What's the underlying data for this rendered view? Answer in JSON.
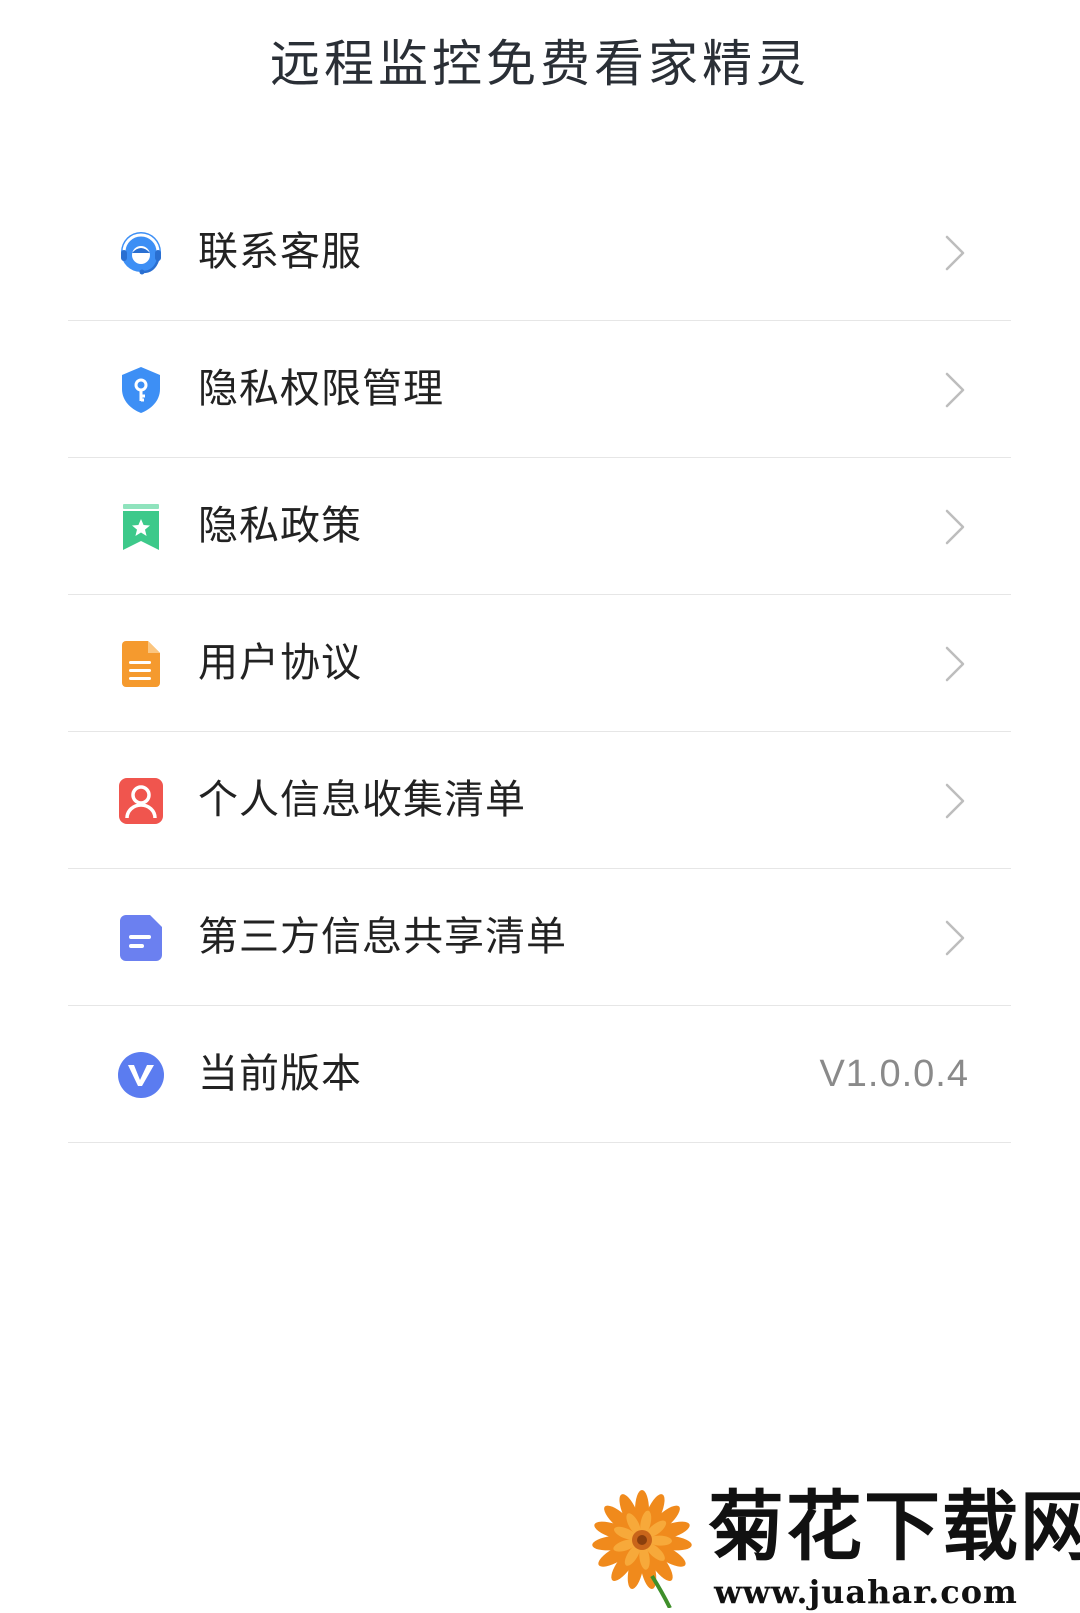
{
  "header": {
    "title": "远程监控免费看家精灵"
  },
  "menu": {
    "items": [
      {
        "label": "联系客服",
        "icon": "customer-service-icon"
      },
      {
        "label": "隐私权限管理",
        "icon": "shield-key-icon"
      },
      {
        "label": "隐私政策",
        "icon": "bookmark-star-icon"
      },
      {
        "label": "用户协议",
        "icon": "document-icon"
      },
      {
        "label": "个人信息收集清单",
        "icon": "user-card-icon"
      },
      {
        "label": "第三方信息共享清单",
        "icon": "note-icon"
      },
      {
        "label": "当前版本",
        "icon": "version-v-icon",
        "value": "V1.0.0.4"
      }
    ]
  },
  "watermark": {
    "title": "菊花下载网",
    "url": "www.juahar.com"
  },
  "colors": {
    "icon_blue": "#3d8ff5",
    "icon_green": "#3dc98a",
    "icon_orange": "#f59a2e",
    "icon_red": "#f0554e",
    "icon_indigo": "#6b80f0",
    "chevron": "#bdbdbd",
    "divider": "#e6e6e6"
  }
}
